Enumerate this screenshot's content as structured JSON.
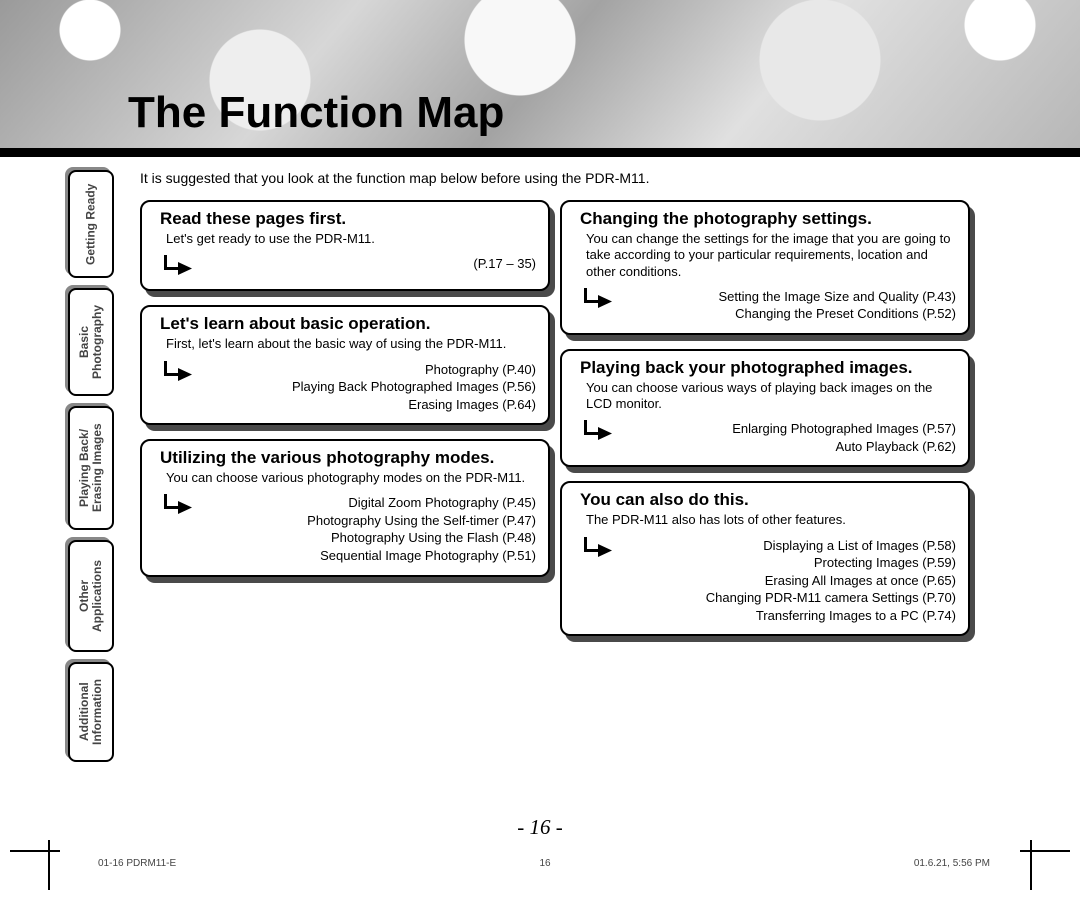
{
  "title": "The Function Map",
  "intro": "It is suggested that you look at the function map below before using the PDR-M11.",
  "tabs": [
    {
      "label": "Getting Ready",
      "height": 108
    },
    {
      "label": "Basic\nPhotography",
      "height": 108
    },
    {
      "label": "Playing Back/\nErasing Images",
      "height": 124
    },
    {
      "label": "Other\nApplications",
      "height": 112
    },
    {
      "label": "Additional\nInformation",
      "height": 100
    }
  ],
  "modules_left": [
    {
      "heading": "Read these pages first.",
      "desc": "Let's get ready to use the PDR-M11.",
      "refs": [
        "(P.17 – 35)"
      ]
    },
    {
      "heading": "Let's learn about basic operation.",
      "desc": "First, let's learn about the basic way of using the PDR-M11.",
      "refs": [
        "Photography (P.40)",
        "Playing Back Photographed Images (P.56)",
        "Erasing Images (P.64)"
      ]
    },
    {
      "heading": "Utilizing the various photography modes.",
      "desc": "You can choose various photography modes on the PDR-M11.",
      "refs": [
        "Digital Zoom Photography (P.45)",
        "Photography Using the Self-timer (P.47)",
        "Photography Using the Flash (P.48)",
        "Sequential Image Photography (P.51)"
      ]
    }
  ],
  "modules_right": [
    {
      "heading": "Changing the photography settings.",
      "desc": "You can change the settings for the image that you are going to take according to your particular requirements, location and other conditions.",
      "refs": [
        "Setting the Image Size and Quality (P.43)",
        "Changing the Preset Conditions (P.52)"
      ]
    },
    {
      "heading": "Playing back your photographed images.",
      "desc": "You can choose various ways of playing back images on the LCD monitor.",
      "refs": [
        "Enlarging Photographed Images (P.57)",
        "Auto Playback (P.62)"
      ]
    },
    {
      "heading": "You can also do this.",
      "desc": "The PDR-M11 also has lots of other features.",
      "refs": [
        "Displaying a List of Images (P.58)",
        "Protecting Images (P.59)",
        "Erasing All Images at once (P.65)",
        "Changing PDR-M11 camera Settings (P.70)",
        "Transferring Images to a PC (P.74)"
      ]
    }
  ],
  "page_number": "- 16 -",
  "footer": {
    "left": "01-16 PDRM11-E",
    "center": "16",
    "right": "01.6.21, 5:56 PM"
  }
}
